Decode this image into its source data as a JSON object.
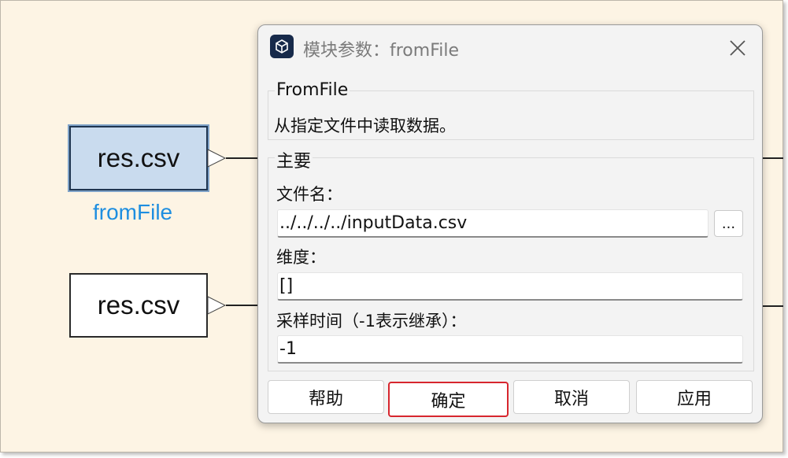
{
  "diagram": {
    "blocks": [
      {
        "label": "res.csv",
        "name": "fromFile",
        "selected": true
      },
      {
        "label": "res.csv",
        "selected": false
      }
    ]
  },
  "dialog": {
    "title": "模块参数：fromFile",
    "icon": "cube-icon",
    "description_group": {
      "title": "FromFile",
      "text": "从指定文件中读取数据。"
    },
    "main_group": {
      "title": "主要",
      "fields": [
        {
          "label": "文件名：",
          "value": "../../../../inputData.csv",
          "has_browse": true
        },
        {
          "label": "维度：",
          "value": "[]"
        },
        {
          "label": "采样时间（-1表示继承）：",
          "value": "-1"
        }
      ],
      "browse_label": "..."
    },
    "buttons": {
      "help": "帮助",
      "ok": "确定",
      "cancel": "取消",
      "apply": "应用"
    },
    "focused_button": "ok",
    "colors": {
      "focus_border": "#d7262e",
      "selected_block_fill": "#c9dbee",
      "block_name_text": "#1e8ee0",
      "canvas_background": "#fdf4e4"
    }
  }
}
